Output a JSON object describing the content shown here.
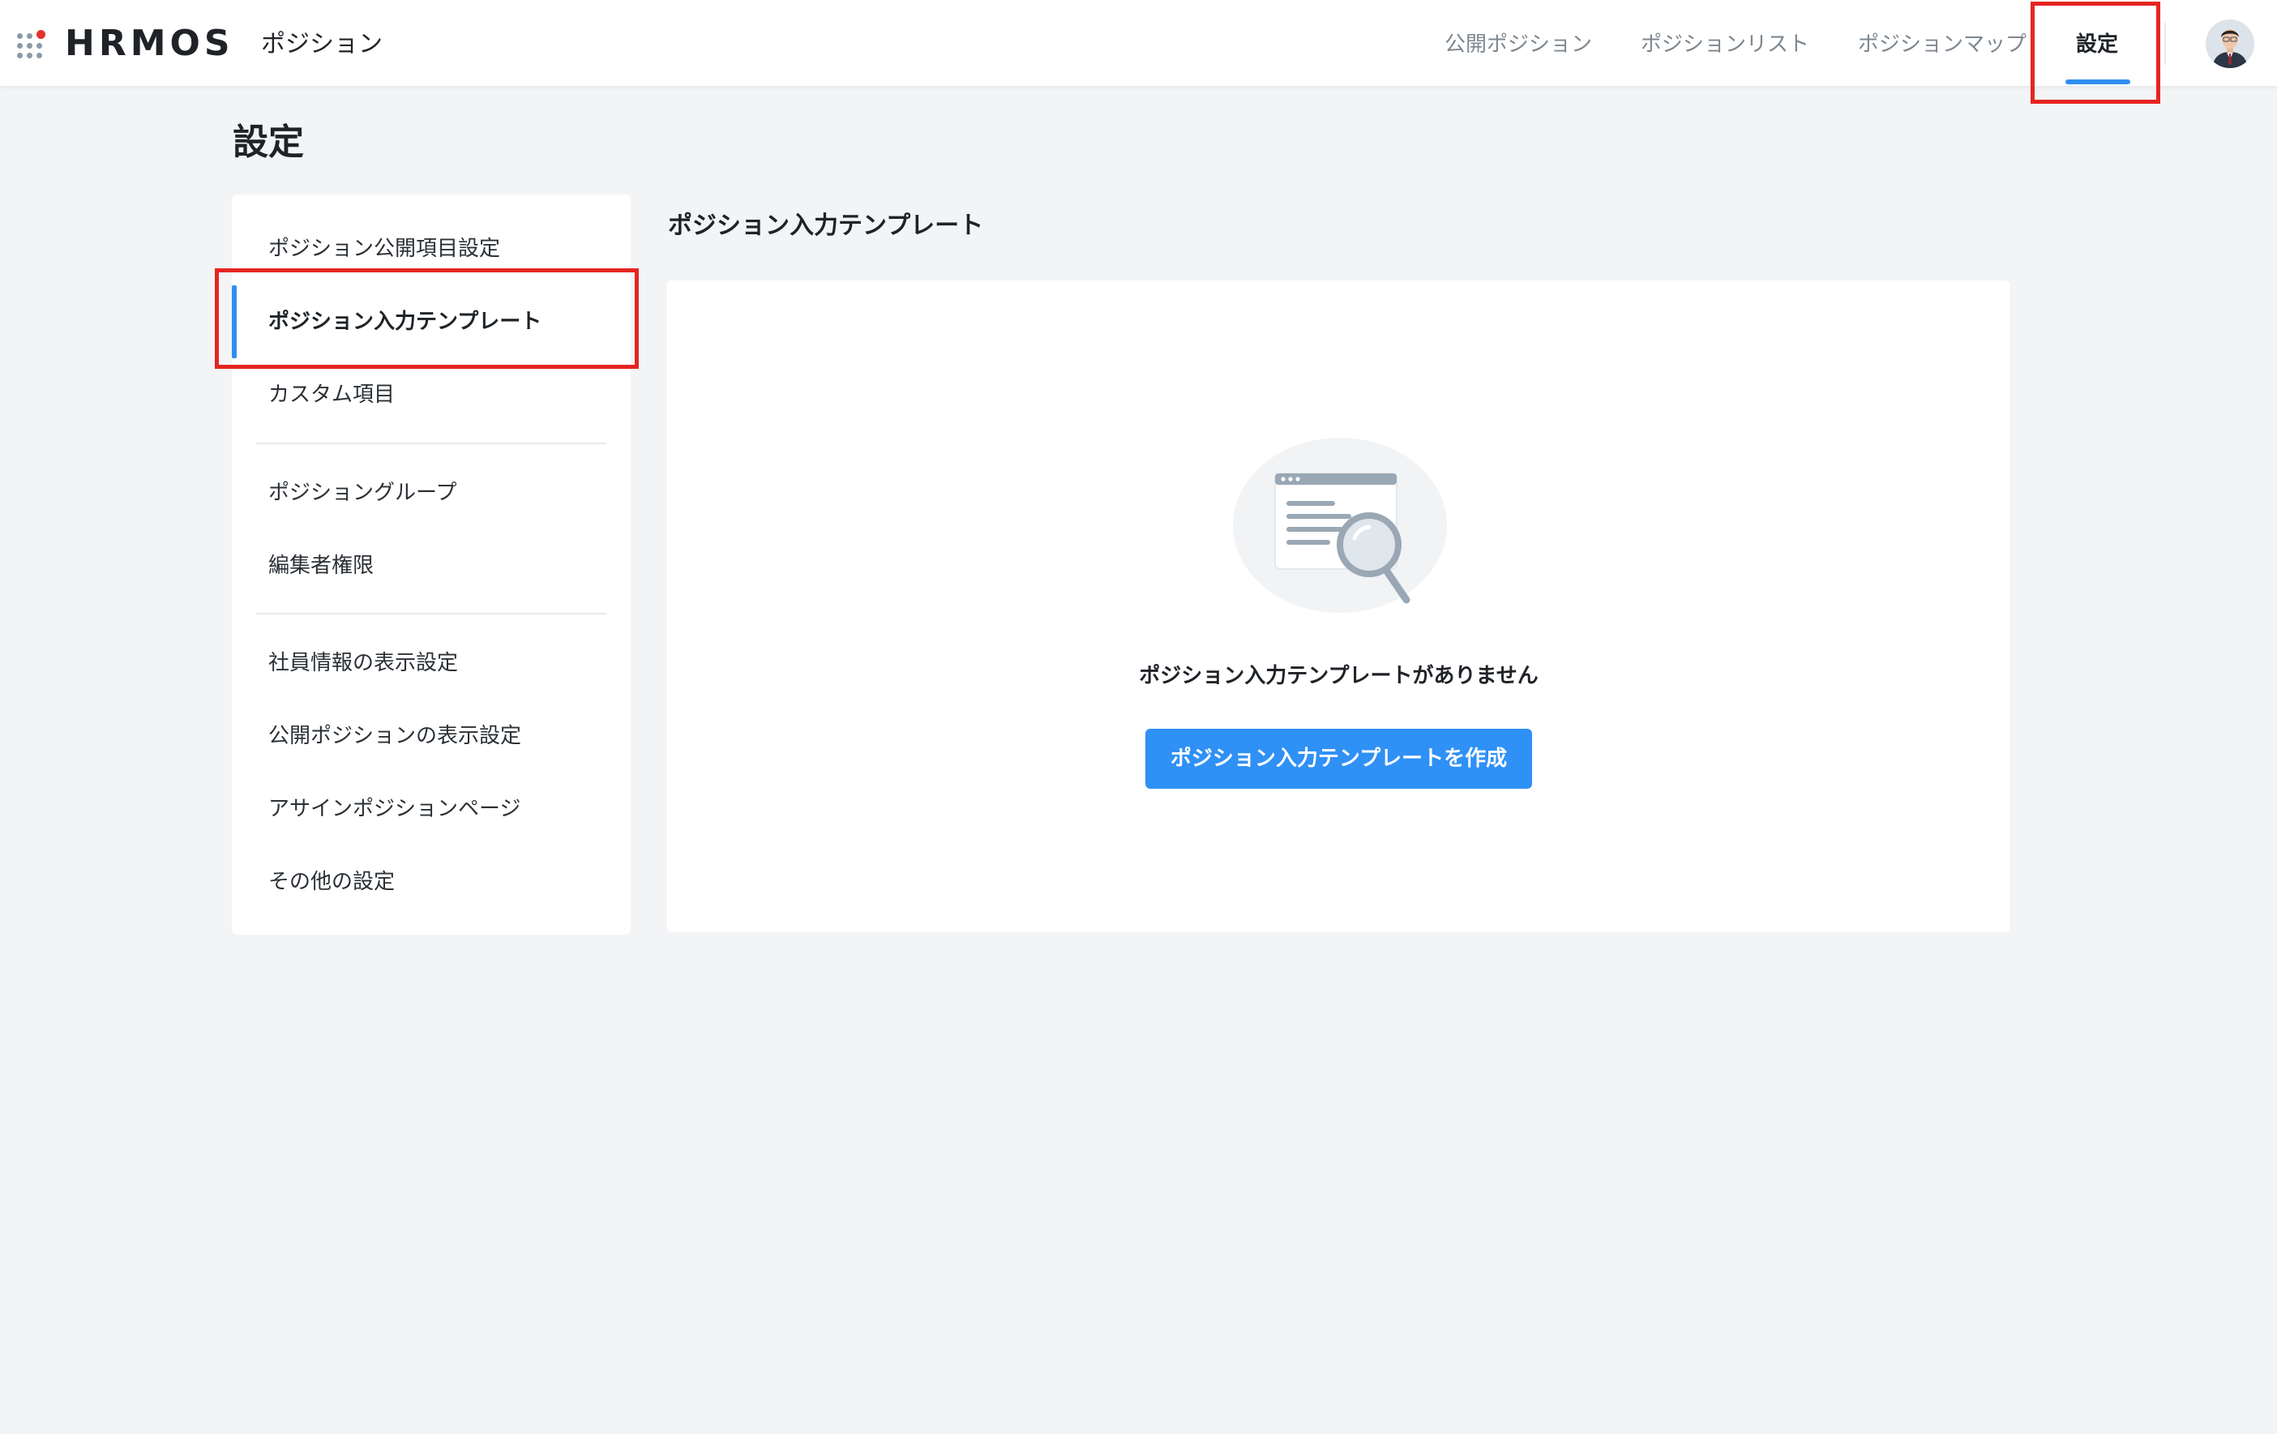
{
  "header": {
    "logo_text": "HRMOS",
    "product_name": "ポジション",
    "nav": [
      {
        "label": "公開ポジション"
      },
      {
        "label": "ポジションリスト"
      },
      {
        "label": "ポジションマップ"
      },
      {
        "label": "設定",
        "active": true
      }
    ],
    "accent_color": "#2f8ff2"
  },
  "page": {
    "title": "設定"
  },
  "sidebar": {
    "items": [
      {
        "label": "ポジション公開項目設定"
      },
      {
        "label": "ポジション入力テンプレート",
        "active": true
      },
      {
        "label": "カスタム項目"
      },
      {
        "label": "ポジショングループ"
      },
      {
        "label": "編集者権限"
      },
      {
        "label": "社員情報の表示設定"
      },
      {
        "label": "公開ポジションの表示設定"
      },
      {
        "label": "アサインポジションページ"
      },
      {
        "label": "その他の設定"
      }
    ]
  },
  "main": {
    "section_title": "ポジション入力テンプレート",
    "empty_state": {
      "illustration": "document-magnifier-illustration",
      "message": "ポジション入力テンプレートがありません",
      "button_label": "ポジション入力テンプレートを作成",
      "button_color": "#2f90f5"
    }
  },
  "annotations": {
    "highlight_color": "#e52521"
  }
}
